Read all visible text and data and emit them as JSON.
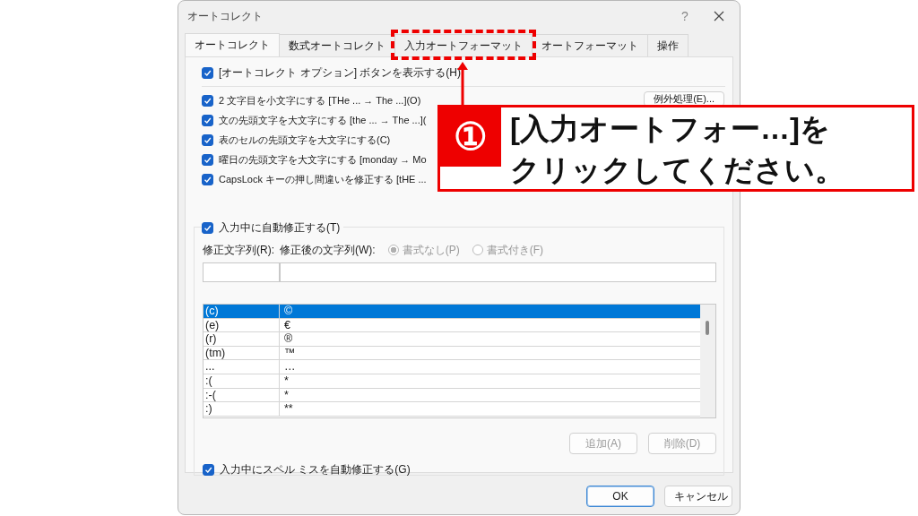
{
  "window": {
    "title": "オートコレクト",
    "help": "?"
  },
  "tabs": [
    {
      "label": "オートコレクト",
      "selected": true
    },
    {
      "label": "数式オートコレクト",
      "selected": false
    },
    {
      "label": "入力オートフォーマット",
      "selected": false,
      "highlighted": true
    },
    {
      "label": "オートフォーマット",
      "selected": false
    },
    {
      "label": "操作",
      "selected": false
    }
  ],
  "top_option": {
    "label": "[オートコレクト オプション] ボタンを表示する(H)",
    "checked": true
  },
  "options": [
    {
      "label": "2 文字目を小文字にする [THe ... → The ...](O)",
      "checked": true
    },
    {
      "label": "文の先頭文字を大文字にする [the ... → The ...](",
      "checked": true
    },
    {
      "label": "表のセルの先頭文字を大文字にする(C)",
      "checked": true
    },
    {
      "label": "曜日の先頭文字を大文字にする [monday →  Mo",
      "checked": true
    },
    {
      "label": "CapsLock キーの押し間違いを修正する [tHE ...",
      "checked": true
    }
  ],
  "exceptions_button": "例外処理(E)...",
  "replace_group": {
    "label": "入力中に自動修正する(T)",
    "checked": true
  },
  "replace_label": "修正文字列(R):",
  "with_label": "修正後の文字列(W):",
  "format_options": [
    {
      "label": "書式なし(P)",
      "selected": true,
      "disabled": true
    },
    {
      "label": "書式付き(F)",
      "selected": false,
      "disabled": true
    }
  ],
  "entries": [
    {
      "replace": "(c)",
      "with": "©",
      "selected": true
    },
    {
      "replace": "(e)",
      "with": "€",
      "selected": false
    },
    {
      "replace": "(r)",
      "with": "®",
      "selected": false
    },
    {
      "replace": "(tm)",
      "with": "™",
      "selected": false
    },
    {
      "replace": "...",
      "with": "…",
      "selected": false
    },
    {
      "replace": ":(",
      "with": "*",
      "selected": false
    },
    {
      "replace": ":-(",
      "with": "*",
      "selected": false
    },
    {
      "replace": ":)",
      "with": "**",
      "selected": false
    }
  ],
  "add_button": {
    "label": "追加(A)",
    "disabled": true
  },
  "delete_button": {
    "label": "削除(D)",
    "disabled": true
  },
  "spell_option": {
    "label": "入力中にスペル ミスを自動修正する(G)",
    "checked": true
  },
  "buttons": [
    {
      "label": "OK",
      "kind": "default"
    },
    {
      "label": "キャンセル",
      "kind": "normal"
    }
  ],
  "callout": {
    "number": "①",
    "lines": [
      "[入力オートフォー…]を",
      "クリックしてください。"
    ]
  }
}
